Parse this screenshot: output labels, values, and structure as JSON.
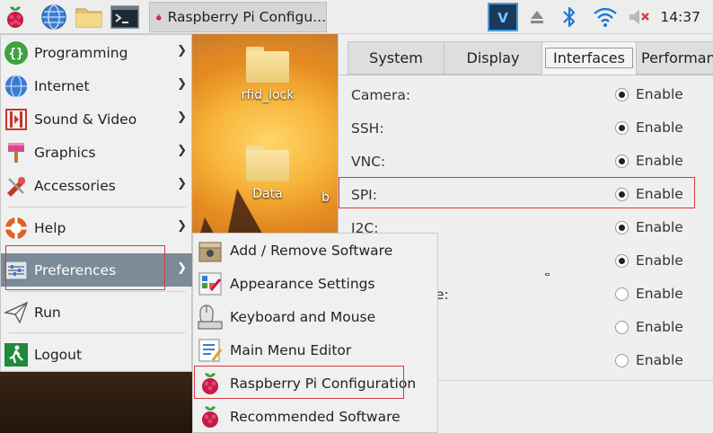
{
  "taskbar": {
    "active_window_title": "Raspberry Pi Configu...",
    "clock": "14:37",
    "icons": [
      "raspberry-menu-icon",
      "web-browser-icon",
      "file-manager-icon",
      "terminal-icon",
      "vnc-icon",
      "eject-icon",
      "bluetooth-icon",
      "wifi-icon",
      "volume-muted-icon"
    ]
  },
  "desktop": {
    "icons": [
      {
        "label": "rfid_lock"
      },
      {
        "label": "Data"
      }
    ],
    "partial_label": "b"
  },
  "menu": {
    "items": [
      {
        "label": "Programming",
        "icon": "programming-icon",
        "submenu": true
      },
      {
        "label": "Internet",
        "icon": "internet-icon",
        "submenu": true
      },
      {
        "label": "Sound & Video",
        "icon": "sound-video-icon",
        "submenu": true
      },
      {
        "label": "Graphics",
        "icon": "graphics-icon",
        "submenu": true
      },
      {
        "label": "Accessories",
        "icon": "accessories-icon",
        "submenu": true
      },
      {
        "label": "Help",
        "icon": "help-icon",
        "submenu": true
      },
      {
        "label": "Preferences",
        "icon": "preferences-icon",
        "submenu": true,
        "selected": true
      },
      {
        "label": "Run",
        "icon": "run-icon",
        "submenu": false
      },
      {
        "label": "Logout",
        "icon": "logout-icon",
        "submenu": false
      }
    ]
  },
  "submenu": {
    "items": [
      {
        "label": "Add / Remove Software",
        "icon": "add-remove-software-icon"
      },
      {
        "label": "Appearance Settings",
        "icon": "appearance-settings-icon"
      },
      {
        "label": "Keyboard and Mouse",
        "icon": "keyboard-mouse-icon"
      },
      {
        "label": "Main Menu Editor",
        "icon": "main-menu-editor-icon"
      },
      {
        "label": "Raspberry Pi Configuration",
        "icon": "raspberry-icon",
        "highlighted": true
      },
      {
        "label": "Recommended Software",
        "icon": "raspberry-icon"
      }
    ]
  },
  "config": {
    "tabs": [
      {
        "label": "System"
      },
      {
        "label": "Display"
      },
      {
        "label": "Interfaces",
        "active": true
      },
      {
        "label": "Performance"
      }
    ],
    "rows": [
      {
        "label": "Camera:",
        "option": "Enable",
        "checked": true
      },
      {
        "label": "SSH:",
        "option": "Enable",
        "checked": true
      },
      {
        "label": "VNC:",
        "option": "Enable",
        "checked": true
      },
      {
        "label": "SPI:",
        "option": "Enable",
        "checked": true
      },
      {
        "label": "I2C:",
        "option": "Enable",
        "checked": true
      },
      {
        "label": "",
        "option": "Enable",
        "checked": true
      },
      {
        "label": "e:",
        "option": "Enable",
        "checked": false
      },
      {
        "label": "",
        "option": "Enable",
        "checked": false
      },
      {
        "label": "",
        "option": "Enable",
        "checked": false
      }
    ]
  },
  "colors": {
    "highlight": "#d33c3c",
    "menu_selected": "#7d8a98",
    "taskbar": "#ededed"
  }
}
